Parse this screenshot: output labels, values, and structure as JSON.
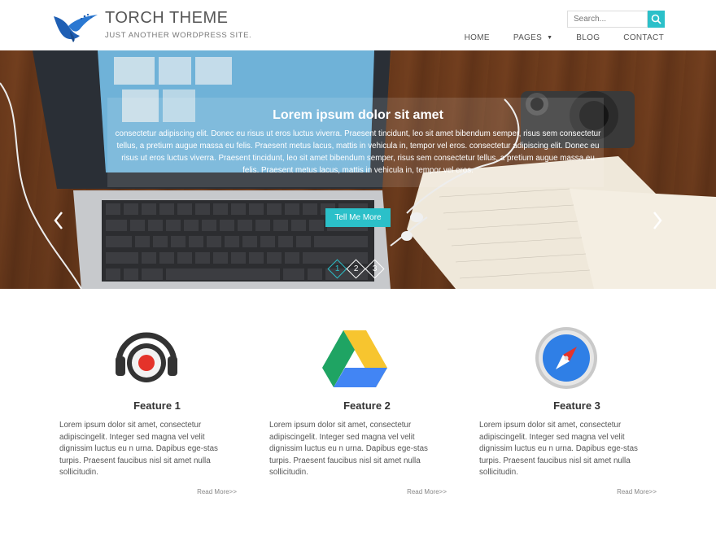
{
  "site": {
    "title": "TORCH THEME",
    "tagline": "JUST ANOTHER WORDPRESS SITE."
  },
  "search": {
    "placeholder": "Search..."
  },
  "nav": {
    "items": [
      "HOME",
      "PAGES",
      "BLOG",
      "CONTACT"
    ]
  },
  "slider": {
    "title": "Lorem ipsum dolor sit amet",
    "text": "consectetur adipiscing elit. Donec eu risus ut eros luctus viverra. Praesent tincidunt, leo sit amet bibendum semper, risus sem consectetur tellus, a pretium augue massa eu felis. Praesent metus lacus, mattis in vehicula in, tempor vel eros. consectetur adipiscing elit. Donec eu risus ut eros luctus viverra. Praesent tincidunt, leo sit amet bibendum semper, risus sem consectetur tellus, a pretium augue massa eu felis. Praesent metus lacus, mattis in vehicula in, tempor vel eros.",
    "button": "Tell Me More",
    "pager": [
      "1",
      "2",
      "3"
    ],
    "active_slide": 1
  },
  "features": [
    {
      "title": "Feature 1",
      "icon": "headphones-record-icon",
      "desc": "Lorem ipsum dolor sit amet, consectetur adipiscingelit. Integer sed magna vel velit dignissim luctus eu n urna. Dapibus ege-stas turpis. Praesent faucibus nisl sit amet nulla sollicitudin.",
      "more": "Read More>>"
    },
    {
      "title": "Feature 2",
      "icon": "google-drive-icon",
      "desc": "Lorem ipsum dolor sit amet, consectetur adipiscingelit. Integer sed magna vel velit dignissim luctus eu n urna. Dapibus ege-stas turpis. Praesent faucibus nisl sit amet nulla sollicitudin.",
      "more": "Read More>>"
    },
    {
      "title": "Feature 3",
      "icon": "compass-icon",
      "desc": "Lorem ipsum dolor sit amet, consectetur adipiscingelit. Integer sed magna vel velit dignissim luctus eu n urna. Dapibus ege-stas turpis. Praesent faucibus nisl sit amet nulla sollicitudin.",
      "more": "Read More>>"
    }
  ],
  "colors": {
    "accent": "#2bc0c9",
    "logo": "#1f5fb4"
  }
}
